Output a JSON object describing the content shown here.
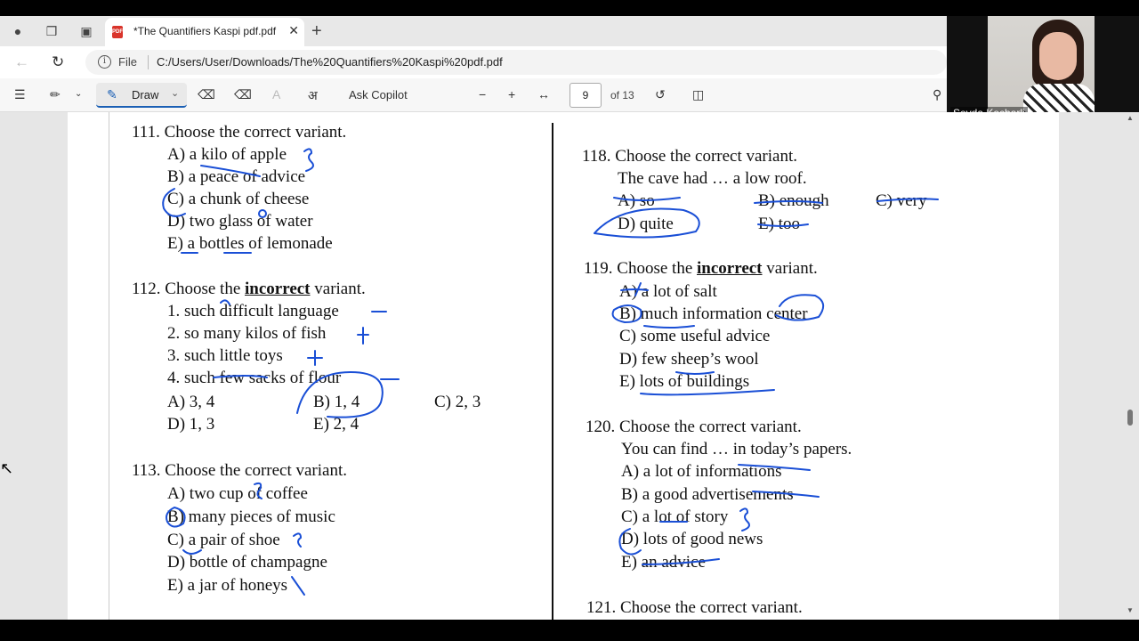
{
  "browser": {
    "tab_title": "*The Quantifiers Kaspi pdf.pdf",
    "url_prefix": "File",
    "url": "C:/Users/User/Downloads/The%20Quantifiers%20Kaspi%20pdf.pdf"
  },
  "pdf_toolbar": {
    "draw_label": "Draw",
    "ask_copilot": "Ask Copilot",
    "current_page": "9",
    "page_total": "of 13"
  },
  "webcam": {
    "name": "Sevda Kocharli"
  },
  "questions": {
    "q111": {
      "title": "111. Choose the correct variant.",
      "options": [
        "A) a kilo of apple",
        "B) a peace of advice",
        "C) a chunk of cheese",
        "D) two glass of water",
        "E) a bottles of lemonade"
      ]
    },
    "q112": {
      "title_pre": "112. Choose the ",
      "title_emph": "incorrect",
      "title_post": " variant.",
      "items": [
        "1. such difficult language",
        "2. so many kilos of fish",
        "3. such little toys",
        "4. such few sacks of flour"
      ],
      "options": [
        "A) 3, 4",
        "B) 1, 4",
        "C) 2, 3",
        "D) 1, 3",
        "E) 2, 4"
      ]
    },
    "q113": {
      "title": "113. Choose the correct variant.",
      "options": [
        "A) two cup of coffee",
        "B) many pieces of music",
        "C) a pair of shoe",
        "D) bottle of champagne",
        "E) a jar of honeys"
      ]
    },
    "q118": {
      "title": "118. Choose the correct variant.",
      "stem": "The cave had … a low roof.",
      "options": [
        "A) so",
        "B) enough",
        "C) very",
        "D) quite",
        "E) too"
      ]
    },
    "q119": {
      "title_pre": "119. Choose the ",
      "title_emph": "incorrect",
      "title_post": " variant.",
      "options": [
        "A) a lot of salt",
        "B) much information center",
        "C) some useful advice",
        "D) few sheep’s wool",
        "E) lots of buildings"
      ]
    },
    "q120": {
      "title": "120. Choose the correct variant.",
      "stem": "You can find … in today’s papers.",
      "options": [
        "A) a lot of informations",
        "B) a good advertisements",
        "C) a lot of story",
        "D) lots of good news",
        "E) an advice"
      ]
    },
    "q121": {
      "title": "121. Choose the correct variant."
    }
  },
  "colors": {
    "ink": "#1a4fd6",
    "accent": "#1a5fb4"
  }
}
